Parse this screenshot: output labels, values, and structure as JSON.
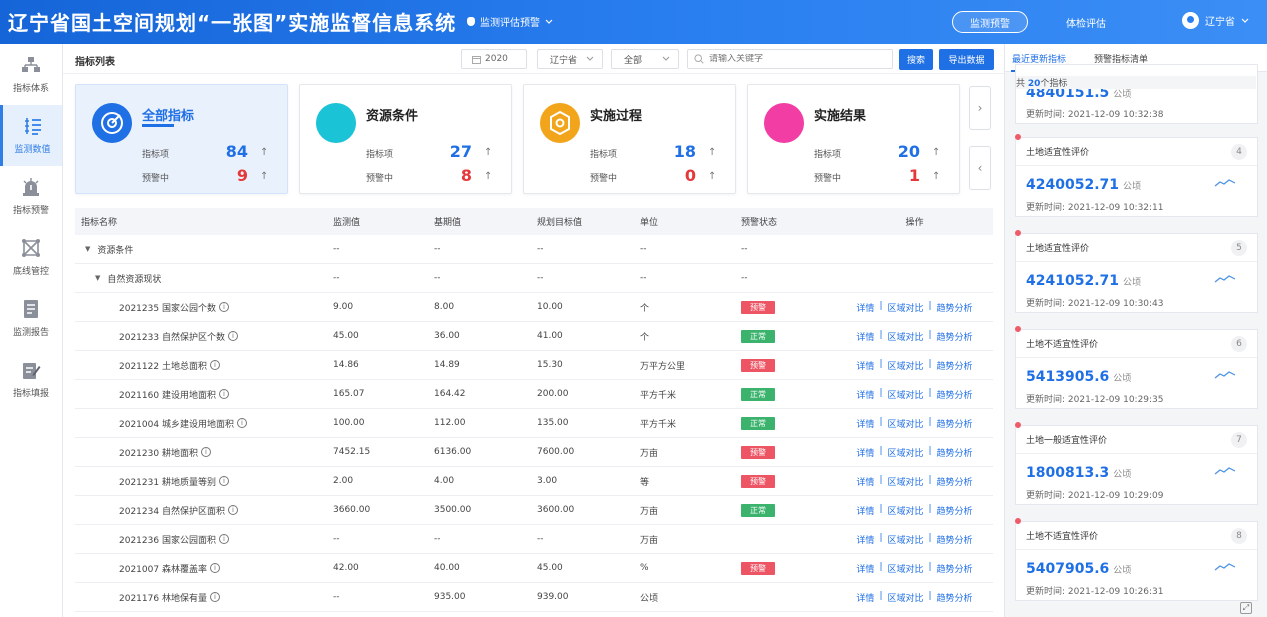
{
  "header": {
    "title": "辽宁省国土空间规划“一张图”实施监督信息系统",
    "nav": "监测评估预警",
    "btn_monitor": "监测预警",
    "btn_check": "体检评估",
    "user": "辽宁省"
  },
  "sidebar": {
    "items": [
      {
        "label": "指标体系",
        "icon": "hierarchy-icon"
      },
      {
        "label": "监测数值",
        "icon": "list-icon"
      },
      {
        "label": "指标预警",
        "icon": "alarm-icon"
      },
      {
        "label": "底线管控",
        "icon": "boundary-icon"
      },
      {
        "label": "监测报告",
        "icon": "report-icon"
      },
      {
        "label": "指标填报",
        "icon": "edit-icon"
      }
    ]
  },
  "toolbar": {
    "title": "指标列表",
    "year": "2020",
    "region": "辽宁省",
    "scope": "全部",
    "search_placeholder": "请输入关键字",
    "search_btn": "搜索",
    "export_btn": "导出数据"
  },
  "cards": [
    {
      "title": "全部指标",
      "label1": "指标项",
      "count": "84",
      "label2": "预警中",
      "warn": "9"
    },
    {
      "title": "资源条件",
      "label1": "指标项",
      "count": "27",
      "label2": "预警中",
      "warn": "8"
    },
    {
      "title": "实施过程",
      "label1": "指标项",
      "count": "18",
      "label2": "预警中",
      "warn": "0"
    },
    {
      "title": "实施结果",
      "label1": "指标项",
      "count": "20",
      "label2": "预警中",
      "warn": "1"
    }
  ],
  "table": {
    "headers": [
      "指标名称",
      "监测值",
      "基期值",
      "规划目标值",
      "单位",
      "预警状态",
      "操作"
    ],
    "ops": {
      "detail": "详情",
      "compare": "区域对比",
      "trend": "趋势分析",
      "sep": "|"
    },
    "groups": [
      {
        "name": "资源条件",
        "c1": "--",
        "c2": "--",
        "c3": "--",
        "c4": "--",
        "c5": "--"
      },
      {
        "name": "自然资源现状",
        "c1": "--",
        "c2": "--",
        "c3": "--",
        "c4": "--",
        "c5": "--"
      }
    ],
    "rows": [
      {
        "name": "2021235 国家公园个数",
        "v": "9.00",
        "base": "8.00",
        "target": "10.00",
        "unit": "个",
        "status": "预警",
        "type": "warn"
      },
      {
        "name": "2021233 自然保护区个数",
        "v": "45.00",
        "base": "36.00",
        "target": "41.00",
        "unit": "个",
        "status": "正常",
        "type": "ok"
      },
      {
        "name": "2021122 土地总面积",
        "v": "14.86",
        "base": "14.89",
        "target": "15.30",
        "unit": "万平方公里",
        "status": "预警",
        "type": "warn"
      },
      {
        "name": "2021160 建设用地面积",
        "v": "165.07",
        "base": "164.42",
        "target": "200.00",
        "unit": "平方千米",
        "status": "正常",
        "type": "ok"
      },
      {
        "name": "2021004 城乡建设用地面积",
        "v": "100.00",
        "base": "112.00",
        "target": "135.00",
        "unit": "平方千米",
        "status": "正常",
        "type": "ok"
      },
      {
        "name": "2021230 耕地面积",
        "v": "7452.15",
        "base": "6136.00",
        "target": "7600.00",
        "unit": "万亩",
        "status": "预警",
        "type": "warn"
      },
      {
        "name": "2021231 耕地质量等别",
        "v": "2.00",
        "base": "4.00",
        "target": "3.00",
        "unit": "等",
        "status": "预警",
        "type": "warn"
      },
      {
        "name": "2021234 自然保护区面积",
        "v": "3660.00",
        "base": "3500.00",
        "target": "3600.00",
        "unit": "万亩",
        "status": "正常",
        "type": "ok"
      },
      {
        "name": "2021236 国家公园面积",
        "v": "--",
        "base": "--",
        "target": "--",
        "unit": "万亩",
        "status": "",
        "type": ""
      },
      {
        "name": "2021007 森林覆盖率",
        "v": "42.00",
        "base": "40.00",
        "target": "45.00",
        "unit": "%",
        "status": "预警",
        "type": "warn"
      },
      {
        "name": "2021176 林地保有量",
        "v": "--",
        "base": "935.00",
        "target": "939.00",
        "unit": "公顷",
        "status": "",
        "type": ""
      }
    ]
  },
  "right": {
    "tab1": "最近更新指标",
    "tab2": "预警指标清单",
    "count_prefix": "共 ",
    "count": "20",
    "count_suffix": "个指标",
    "time_label": "更新时间:",
    "partial": {
      "value": "4840151.5",
      "unit": "公顷",
      "time": "2021-12-09 10:32:38"
    },
    "items": [
      {
        "title": "土地适宜性评价",
        "idx": "4",
        "value": "4240052.71",
        "unit": "公顷",
        "time": "2021-12-09 10:32:11"
      },
      {
        "title": "土地适宜性评价",
        "idx": "5",
        "value": "4241052.71",
        "unit": "公顷",
        "time": "2021-12-09 10:30:43"
      },
      {
        "title": "土地不适宜性评价",
        "idx": "6",
        "value": "5413905.6",
        "unit": "公顷",
        "time": "2021-12-09 10:29:35"
      },
      {
        "title": "土地一般适宜性评价",
        "idx": "7",
        "value": "1800813.3",
        "unit": "公顷",
        "time": "2021-12-09 10:29:09"
      },
      {
        "title": "土地不适宜性评价",
        "idx": "8",
        "value": "5407905.6",
        "unit": "公顷",
        "time": "2021-12-09 10:26:31"
      }
    ]
  },
  "colors": {
    "primary": "#1f6fe5",
    "warn": "#ed5565",
    "ok": "#3bb36d",
    "cyan": "#1bc3d6",
    "orange": "#f2a51a",
    "pink": "#f23ea4"
  }
}
